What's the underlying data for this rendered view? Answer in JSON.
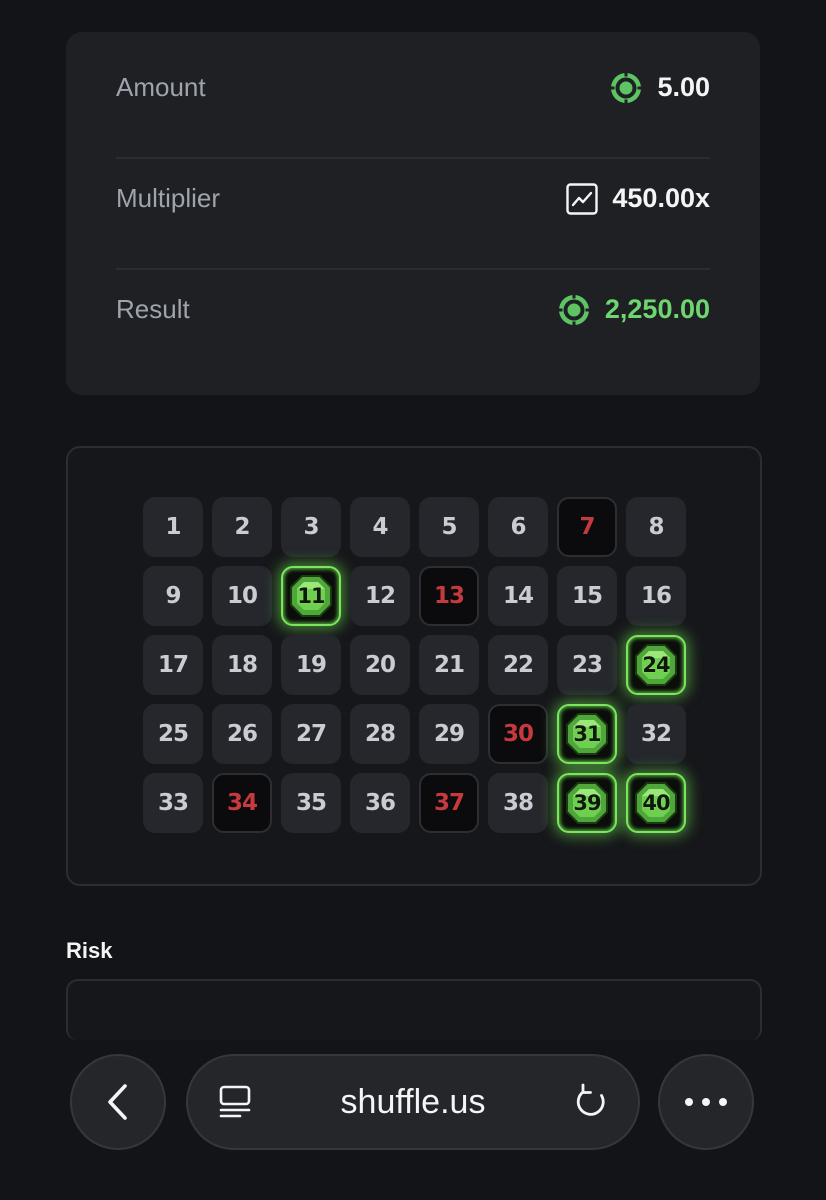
{
  "summary": {
    "amount_label": "Amount",
    "amount_value": "5.00",
    "amount_icon": "coin-icon",
    "multiplier_label": "Multiplier",
    "multiplier_value": "450.00x",
    "multiplier_icon": "chart-icon",
    "result_label": "Result",
    "result_value": "2,250.00",
    "result_icon": "coin-icon",
    "colors": {
      "result_green": "#6ed66f",
      "label_gray": "#9ea3ad"
    }
  },
  "board": {
    "cells": [
      {
        "n": "1",
        "state": "normal"
      },
      {
        "n": "2",
        "state": "normal"
      },
      {
        "n": "3",
        "state": "normal"
      },
      {
        "n": "4",
        "state": "normal"
      },
      {
        "n": "5",
        "state": "normal"
      },
      {
        "n": "6",
        "state": "normal"
      },
      {
        "n": "7",
        "state": "miss"
      },
      {
        "n": "8",
        "state": "normal"
      },
      {
        "n": "9",
        "state": "normal"
      },
      {
        "n": "10",
        "state": "normal"
      },
      {
        "n": "11",
        "state": "hit"
      },
      {
        "n": "12",
        "state": "normal"
      },
      {
        "n": "13",
        "state": "miss"
      },
      {
        "n": "14",
        "state": "normal"
      },
      {
        "n": "15",
        "state": "normal"
      },
      {
        "n": "16",
        "state": "normal"
      },
      {
        "n": "17",
        "state": "normal"
      },
      {
        "n": "18",
        "state": "normal"
      },
      {
        "n": "19",
        "state": "normal"
      },
      {
        "n": "20",
        "state": "normal"
      },
      {
        "n": "21",
        "state": "normal"
      },
      {
        "n": "22",
        "state": "normal"
      },
      {
        "n": "23",
        "state": "normal"
      },
      {
        "n": "24",
        "state": "hit"
      },
      {
        "n": "25",
        "state": "normal"
      },
      {
        "n": "26",
        "state": "normal"
      },
      {
        "n": "27",
        "state": "normal"
      },
      {
        "n": "28",
        "state": "normal"
      },
      {
        "n": "29",
        "state": "normal"
      },
      {
        "n": "30",
        "state": "miss"
      },
      {
        "n": "31",
        "state": "hit"
      },
      {
        "n": "32",
        "state": "normal"
      },
      {
        "n": "33",
        "state": "normal"
      },
      {
        "n": "34",
        "state": "miss"
      },
      {
        "n": "35",
        "state": "normal"
      },
      {
        "n": "36",
        "state": "normal"
      },
      {
        "n": "37",
        "state": "miss"
      },
      {
        "n": "38",
        "state": "normal"
      },
      {
        "n": "39",
        "state": "hit"
      },
      {
        "n": "40",
        "state": "hit"
      }
    ],
    "colors": {
      "hit_glow": "#7ae65b",
      "miss_text": "#c63a3e"
    }
  },
  "risk": {
    "label": "Risk"
  },
  "browser": {
    "url": "shuffle.us",
    "back_icon": "back-chevron-icon",
    "tabs_icon": "tabs-icon",
    "reload_icon": "reload-icon",
    "more_icon": "more-dots-icon"
  }
}
